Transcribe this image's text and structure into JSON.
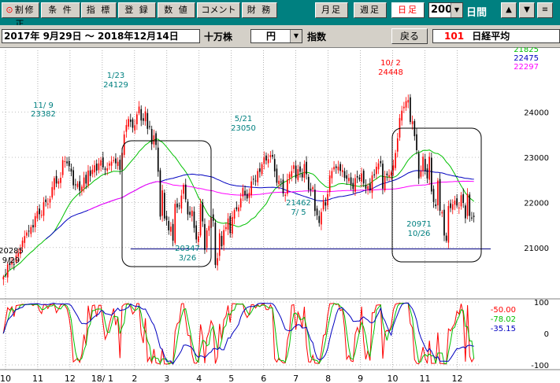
{
  "toolbar": {
    "buttons": [
      {
        "label_prefix": "⊙",
        "label": "割修正",
        "left": 0
      },
      {
        "label": "条 件"
      },
      {
        "label": "指 標"
      },
      {
        "label": "登 録"
      },
      {
        "label": "数 値"
      },
      {
        "label": "コメント"
      },
      {
        "label": "財 務"
      }
    ],
    "period_buttons": [
      "月足",
      "週足",
      "日足"
    ],
    "active_period": "日足",
    "period_count": "200",
    "period_unit": "日間",
    "arrow_up": "▲",
    "arrow_down": "▼",
    "menu_icon": "≡",
    "dropdown_arrow": "▼"
  },
  "infobar": {
    "date_range": "2017年  9月29日  ～ 2018年12月14日",
    "volume_unit": "十万株",
    "currency": "円",
    "index_label": "指数",
    "back_label": "戻る",
    "code": "101",
    "name": "日経平均"
  },
  "colors": {
    "up_candle": "#ff0000",
    "down_candle": "#000000",
    "ma_short": "#00c000",
    "ma_medium": "#0000c0",
    "ma_long": "#ff00ff",
    "annotation": "#008080",
    "annotation_high": "#ff0000",
    "support_line": "#000080",
    "osc_a": "#ff0000",
    "osc_b": "#00c000",
    "osc_c": "#0000c0"
  },
  "chart_data": [
    {
      "type": "candlestick",
      "yticks": [
        21000,
        22000,
        23000,
        24000
      ],
      "ylim": [
        19900,
        25300
      ],
      "month_labels": [
        "10",
        "11",
        "12",
        "18/ 1",
        "2",
        "3",
        "4",
        "5",
        "6",
        "7",
        "8",
        "9",
        "10",
        "11",
        "12"
      ],
      "close": [
        20356,
        20400,
        20627,
        20614,
        20690,
        20628,
        20823,
        20881,
        20954,
        21155,
        21255,
        21336,
        21363,
        21457,
        21448,
        21697,
        21805,
        21739,
        21723,
        22011,
        22008,
        21977,
        22081,
        22340,
        22539,
        22420,
        22472,
        22548,
        22938,
        22914,
        22868,
        22804,
        22685,
        22380,
        22397,
        22416,
        22261,
        22351,
        22553,
        22419,
        22708,
        22587,
        22726,
        22823,
        22707,
        22866,
        22938,
        22777,
        22725,
        22758,
        22866,
        22903,
        22939,
        22868,
        22902,
        22724,
        23099,
        23506,
        23714,
        23849,
        23787,
        23654,
        23710,
        23952,
        24124,
        23816,
        23808,
        24017,
        23631,
        23669,
        23291,
        23486,
        23274,
        22682,
        21687,
        22268,
        21645,
        21610,
        21382,
        21464,
        21154,
        21970,
        21892,
        21925,
        22153,
        22389,
        22068,
        21736,
        21724,
        21820,
        21437,
        21181,
        21252,
        21968,
        21581,
        20950,
        21380,
        21480,
        21676,
        21591,
        20617,
        20766,
        21317,
        21031,
        21388,
        21454,
        21645,
        21319,
        21678,
        21835,
        21847,
        21892,
        22088,
        22319,
        22158,
        22088,
        22215,
        22467,
        22508,
        22473,
        22697,
        22678,
        22848,
        23002,
        22930,
        22960,
        23050,
        23011,
        22690,
        22437,
        22481,
        22450,
        22201,
        22171,
        22509,
        22626,
        22694,
        22823,
        22539,
        22738,
        22680,
        22555,
        22851,
        22625,
        22278,
        22270,
        22338,
        21812,
        21717,
        21546,
        21788,
        22052,
        21931,
        22187,
        22597,
        22695,
        22788,
        22764,
        22794,
        22698,
        22717,
        22544,
        22525,
        22544,
        22396,
        22298,
        22540,
        22553,
        22507,
        22644,
        22420,
        22304,
        22362,
        22271,
        22600,
        22601,
        22792,
        22865,
        22869,
        22307,
        22580,
        22604,
        22606,
        22664,
        22821,
        23095,
        23420,
        23869,
        24033,
        24120,
        24245,
        24270,
        23783,
        23797,
        23469,
        23157,
        22531,
        22694,
        23014,
        22695,
        22532,
        23012,
        22243,
        22010,
        21920,
        22485,
        21816,
        21792,
        21268,
        21153,
        21920,
        21876,
        21962,
        22041,
        21931,
        21888,
        22160,
        21990,
        21649,
        22188,
        21702,
        21645,
        21680
      ],
      "annotations": [
        {
          "value": "24129",
          "date": "1/23",
          "color": "annotation"
        },
        {
          "value": "23382",
          "date": "11/ 9",
          "color": "annotation"
        },
        {
          "value": "20285",
          "date": "9/29",
          "color": "text"
        },
        {
          "value": "20347",
          "date": "3/26",
          "color": "annotation"
        },
        {
          "value": "23050",
          "date": "5/21",
          "color": "annotation"
        },
        {
          "value": "21462",
          "date": "7/ 5",
          "color": "annotation"
        },
        {
          "value": "24448",
          "date": "10/ 2",
          "color": "annotation_high"
        },
        {
          "value": "20971",
          "date": "10/26",
          "color": "annotation"
        }
      ],
      "legend": [
        {
          "value": "21825",
          "color": "ma_short"
        },
        {
          "value": "22475",
          "color": "ma_medium"
        },
        {
          "value": "22297",
          "color": "ma_long"
        }
      ],
      "support_level": 20971
    },
    {
      "type": "oscillator",
      "yticks": [
        100,
        0,
        -100
      ],
      "ylim": [
        -110,
        110
      ],
      "legend": [
        {
          "value": "-50.00",
          "color": "osc_a"
        },
        {
          "value": "-78.02",
          "color": "osc_b"
        },
        {
          "value": "-35.15",
          "color": "osc_c"
        }
      ]
    }
  ]
}
